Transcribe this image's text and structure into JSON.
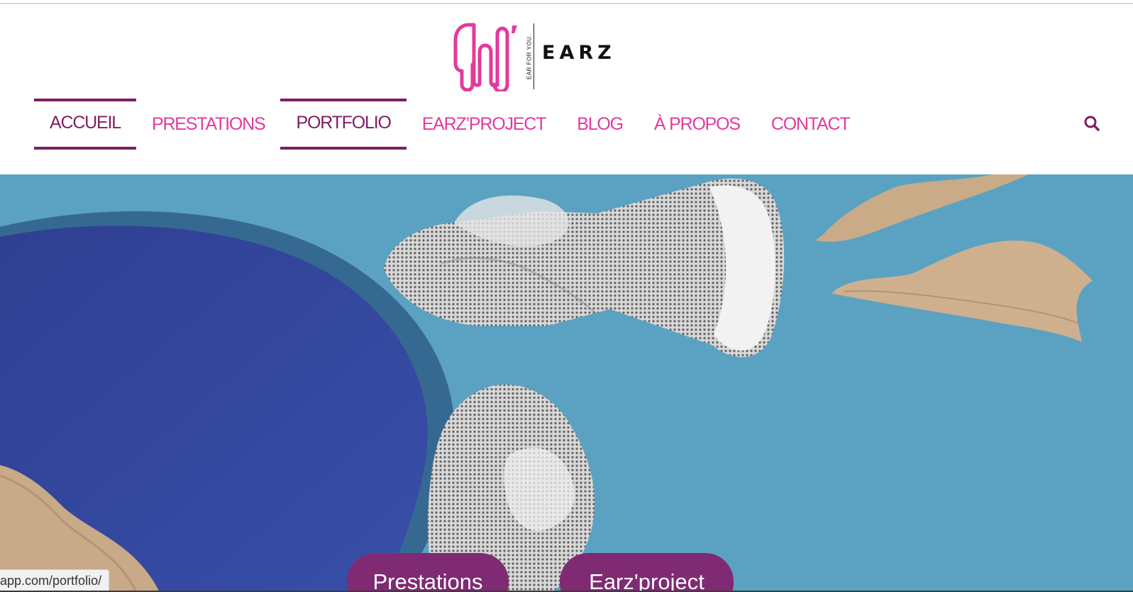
{
  "brand": {
    "wordmark": "EARZ",
    "tagline": "EAR FOR YOU.",
    "logo_color": "#e4399c"
  },
  "nav": {
    "items": [
      {
        "label": "ACCUEIL",
        "active": true
      },
      {
        "label": "PRESTATIONS",
        "active": false
      },
      {
        "label": "PORTFOLIO",
        "active": true
      },
      {
        "label": "EARZ’PROJECT",
        "active": false
      },
      {
        "label": "BLOG",
        "active": false
      },
      {
        "label": "À PROPOS",
        "active": false
      },
      {
        "label": "CONTACT",
        "active": false
      }
    ],
    "active_color": "#7d1e63",
    "inactive_color": "#e4399c",
    "search_icon": "search-icon"
  },
  "hero": {
    "buttons": [
      {
        "label": "Prestations"
      },
      {
        "label": "Earz'project"
      }
    ],
    "button_color": "#7f2a73"
  },
  "status_bar": {
    "url": "app.com/portfolio/"
  }
}
